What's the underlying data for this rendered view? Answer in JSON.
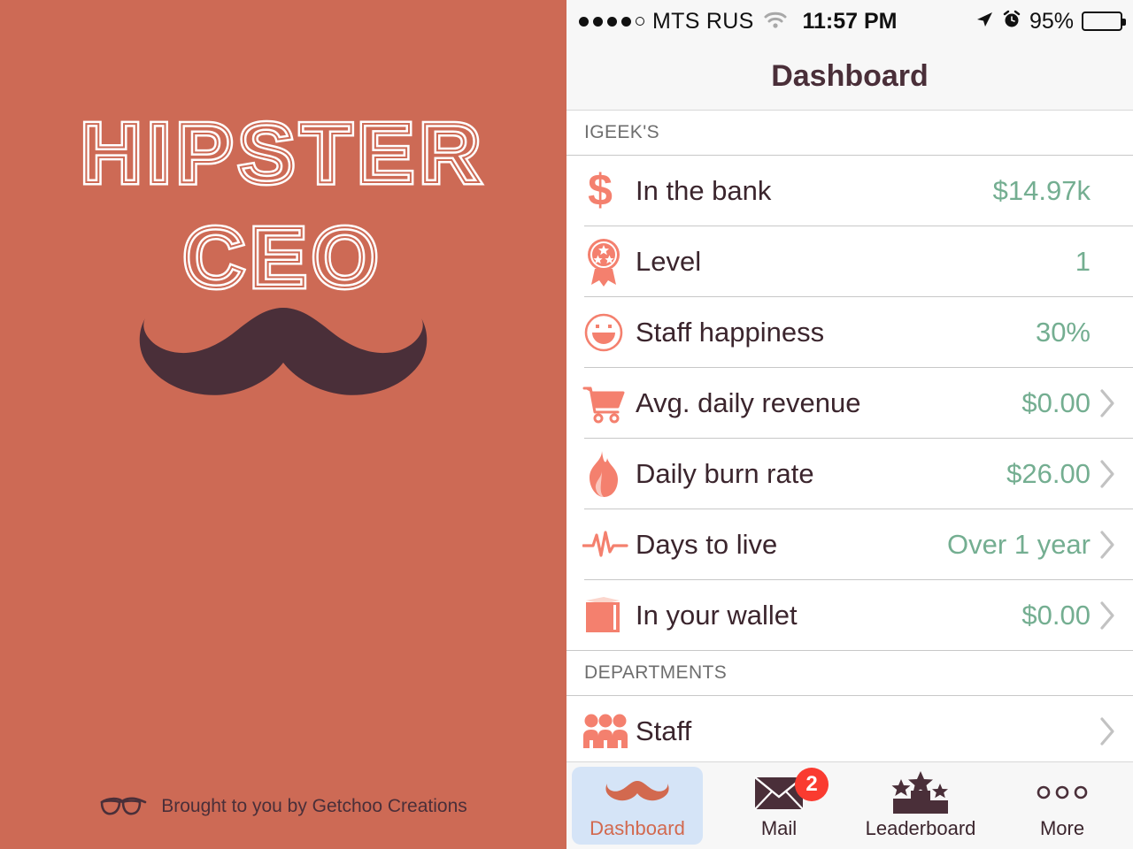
{
  "brand": {
    "logo_line1": "HIPSTER",
    "logo_line2": "CEO",
    "credit": "Brought to you by Getchoo Creations",
    "bg_color": "#CD6A55",
    "mustache_color": "#4A2F39"
  },
  "statusbar": {
    "carrier": "MTS RUS",
    "time": "11:57 PM",
    "battery_percent": "95%",
    "signal_dots_filled": 4,
    "signal_dots_total": 5
  },
  "navbar": {
    "title": "Dashboard"
  },
  "sections": [
    {
      "header": "IGEEK'S",
      "rows": [
        {
          "icon": "dollar-sign-icon",
          "label": "In the bank",
          "value": "$14.97k",
          "chevron": false
        },
        {
          "icon": "award-ribbon-icon",
          "label": "Level",
          "value": "1",
          "chevron": false
        },
        {
          "icon": "smiley-face-icon",
          "label": "Staff happiness",
          "value": "30%",
          "chevron": false
        },
        {
          "icon": "shopping-cart-icon",
          "label": "Avg. daily revenue",
          "value": "$0.00",
          "chevron": true
        },
        {
          "icon": "flame-icon",
          "label": "Daily burn rate",
          "value": "$26.00",
          "chevron": true
        },
        {
          "icon": "heartbeat-icon",
          "label": "Days to live",
          "value": "Over 1 year",
          "chevron": true
        },
        {
          "icon": "wallet-icon",
          "label": "In your wallet",
          "value": "$0.00",
          "chevron": true
        }
      ]
    },
    {
      "header": "DEPARTMENTS",
      "rows": [
        {
          "icon": "staff-people-icon",
          "label": "Staff",
          "value": "",
          "chevron": true
        }
      ]
    }
  ],
  "tabbar": {
    "tabs": [
      {
        "label": "Dashboard",
        "icon": "mustache-icon",
        "selected": true,
        "badge": ""
      },
      {
        "label": "Mail",
        "icon": "envelope-icon",
        "selected": false,
        "badge": "2"
      },
      {
        "label": "Leaderboard",
        "icon": "podium-stars-icon",
        "selected": false,
        "badge": ""
      },
      {
        "label": "More",
        "icon": "three-circles-icon",
        "selected": false,
        "badge": ""
      }
    ]
  },
  "colors": {
    "accent_salmon": "#F4806E",
    "value_green": "#74AE91",
    "text_dark": "#3B252D",
    "badge_red": "#FA3B30",
    "selected_tab_bg": "#D5E4F7",
    "selected_tab_text": "#D2694F"
  }
}
